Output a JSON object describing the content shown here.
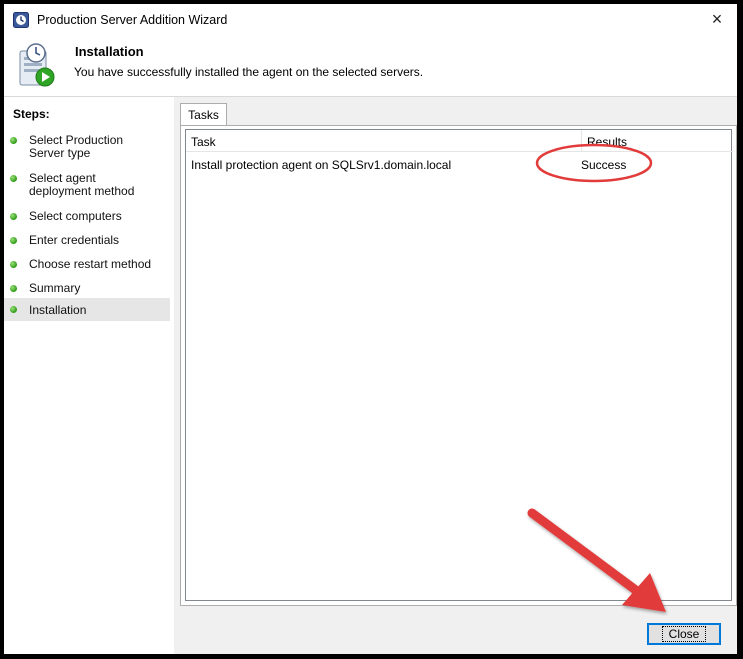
{
  "window": {
    "title": "Production Server Addition Wizard",
    "close_glyph": "×"
  },
  "header": {
    "title": "Installation",
    "subtitle": "You have successfully installed the agent on the selected servers."
  },
  "steps": {
    "title": "Steps:",
    "items": [
      {
        "label": "Select Production Server type",
        "status": "complete"
      },
      {
        "label": "Select agent deployment method",
        "status": "complete"
      },
      {
        "label": "Select computers",
        "status": "complete"
      },
      {
        "label": "Enter credentials",
        "status": "complete"
      },
      {
        "label": "Choose restart method",
        "status": "complete"
      },
      {
        "label": "Summary",
        "status": "complete"
      },
      {
        "label": "Installation",
        "status": "current"
      }
    ]
  },
  "tabs": [
    {
      "label": "Tasks"
    }
  ],
  "table": {
    "columns": [
      "Task",
      "Results"
    ],
    "rows": [
      {
        "task": "Install protection agent on SQLSrv1.domain.local",
        "result": "Success"
      }
    ]
  },
  "footer": {
    "close_label": "Close"
  },
  "annotations": {
    "highlight_color": "#e23b3b",
    "arrow_color": "#e23b3b"
  },
  "icons": {
    "app": "clock-shield-icon",
    "header": "server-clock-install-icon",
    "step_dot": "green-dot-icon"
  }
}
